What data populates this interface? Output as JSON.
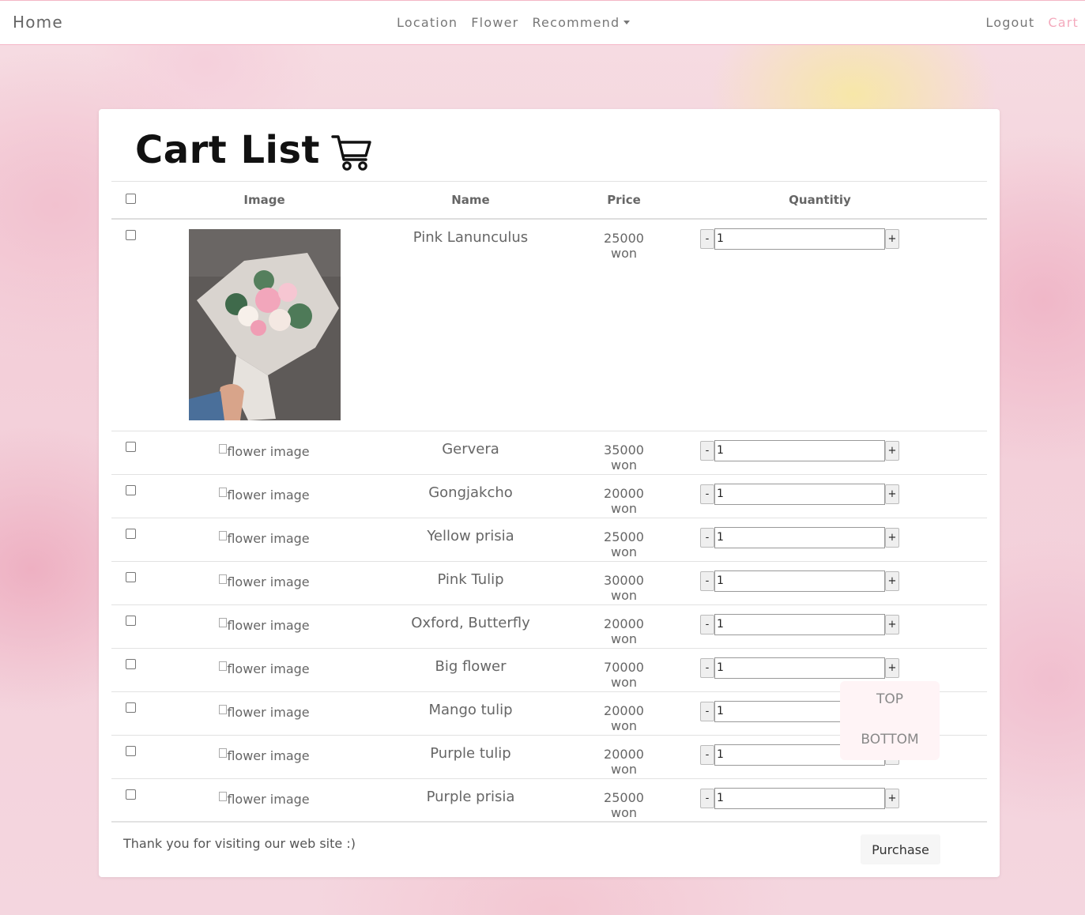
{
  "nav": {
    "brand": "Home",
    "center": [
      "Location",
      "Flower",
      "Recommend"
    ],
    "right": [
      "Logout",
      "Cart"
    ]
  },
  "page": {
    "title": "Cart List"
  },
  "table": {
    "headers": [
      "Image",
      "Name",
      "Price",
      "Quantitiy"
    ],
    "alt_text": "flower image",
    "rows": [
      {
        "name": "Pink Lanunculus",
        "price": "25000 won",
        "qty": "1"
      },
      {
        "name": "Gervera",
        "price": "35000 won",
        "qty": "1"
      },
      {
        "name": "Gongjakcho",
        "price": "20000 won",
        "qty": "1"
      },
      {
        "name": "Yellow prisia",
        "price": "25000 won",
        "qty": "1"
      },
      {
        "name": "Pink Tulip",
        "price": "30000 won",
        "qty": "1"
      },
      {
        "name": "Oxford, Butterfly",
        "price": "20000 won",
        "qty": "1"
      },
      {
        "name": "Big flower",
        "price": "70000 won",
        "qty": "1"
      },
      {
        "name": "Mango tulip",
        "price": "20000 won",
        "qty": "1"
      },
      {
        "name": "Purple tulip",
        "price": "20000 won",
        "qty": "1"
      },
      {
        "name": "Purple prisia",
        "price": "25000 won",
        "qty": "1"
      }
    ],
    "minus": "-",
    "plus": "+"
  },
  "footer": {
    "text": "Thank you for visiting our web site :)",
    "purchase": "Purchase"
  },
  "floating": {
    "top": "TOP",
    "bottom": "BOTTOM"
  },
  "colors": {
    "accent_pink": "#f4aabd",
    "nav_border": "#f4b6c6"
  }
}
